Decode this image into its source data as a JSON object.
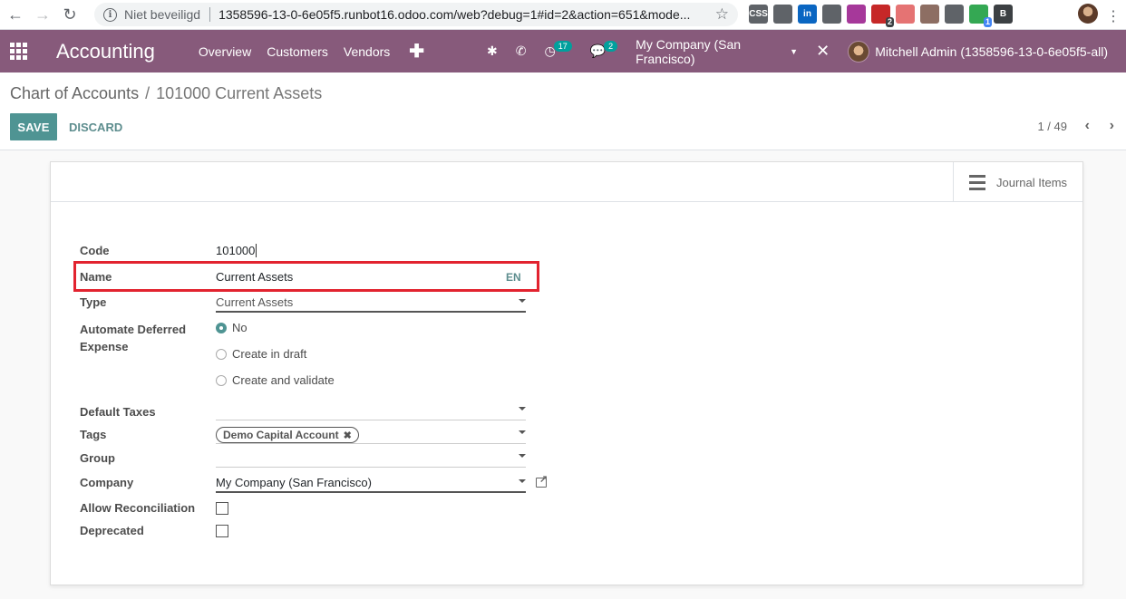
{
  "browser": {
    "security_label": "Niet beveiligd",
    "url": "1358596-13-0-6e05f5.runbot16.odoo.com/web?debug=1#id=2&action=651&mode...",
    "extensions": [
      {
        "name": "css-extension-icon",
        "label": "CSS",
        "color": "#5f6368",
        "badge": ""
      },
      {
        "name": "ghost-extension-icon",
        "label": "",
        "color": "#5f6368",
        "badge": ""
      },
      {
        "name": "linkedin-extension-icon",
        "label": "in",
        "color": "#0a66c2",
        "badge": ""
      },
      {
        "name": "drive-extension-icon",
        "label": "",
        "color": "#5f6368",
        "badge": ""
      },
      {
        "name": "timer-extension-icon",
        "label": "",
        "color": "#a6389a",
        "badge": ""
      },
      {
        "name": "calendar-extension-icon",
        "label": "",
        "color": "#c62828",
        "badge": "2"
      },
      {
        "name": "arrow-extension-icon",
        "label": "",
        "color": "#e57373",
        "badge": ""
      },
      {
        "name": "monkey-extension-icon",
        "label": "",
        "color": "#8d6e63",
        "badge": ""
      },
      {
        "name": "car-extension-icon",
        "label": "",
        "color": "#5f6368",
        "badge": ""
      },
      {
        "name": "green-dot-extension-icon",
        "label": "",
        "color": "#34a853",
        "badge": "1"
      },
      {
        "name": "b-extension-icon",
        "label": "B",
        "color": "#3c4043",
        "badge": ""
      }
    ]
  },
  "navbar": {
    "app_name": "Accounting",
    "menu": [
      "Overview",
      "Customers",
      "Vendors"
    ],
    "activity_count": "17",
    "message_count": "2",
    "company": "My Company (San Francisco)",
    "user": "Mitchell Admin (1358596-13-0-6e05f5-all)"
  },
  "breadcrumb": {
    "parent": "Chart of Accounts",
    "current": "101000 Current Assets"
  },
  "actions": {
    "save_label": "SAVE",
    "discard_label": "DISCARD"
  },
  "pager": {
    "value": "1 / 49"
  },
  "stat_button": {
    "label": "Journal Items"
  },
  "form": {
    "code_label": "Code",
    "code_value": "101000",
    "name_label": "Name",
    "name_value": "Current Assets",
    "name_lang": "EN",
    "type_label": "Type",
    "type_value": "Current Assets",
    "deferred_label_1": "Automate Deferred",
    "deferred_label_2": "Expense",
    "deferred_options": [
      "No",
      "Create in draft",
      "Create and validate"
    ],
    "deferred_selected": "No",
    "default_taxes_label": "Default Taxes",
    "tags_label": "Tags",
    "tag_value": "Demo Capital Account",
    "group_label": "Group",
    "company_label": "Company",
    "company_value": "My Company (San Francisco)",
    "reconcile_label": "Allow Reconciliation",
    "deprecated_label": "Deprecated"
  },
  "highlight_color": "#e2232f",
  "brand_color": "#875a7b",
  "accent_color": "#4f9493"
}
